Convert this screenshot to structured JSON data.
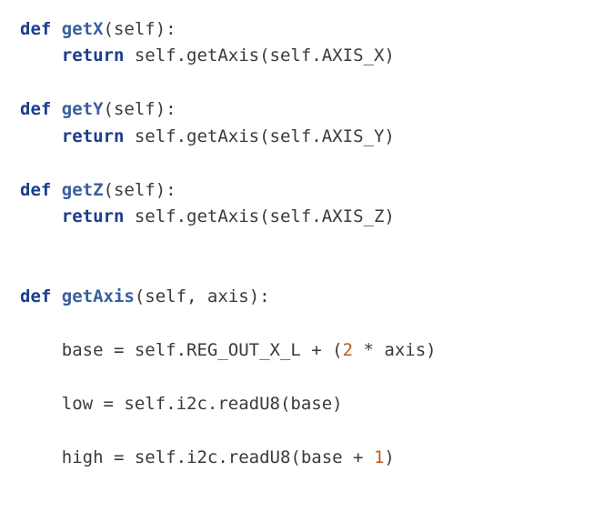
{
  "code": {
    "line1_def": "def",
    "line1_fn": "getX",
    "line1_rest": "(self):",
    "line2_ret": "return",
    "line2_rest": " self.getAxis(self.AXIS_X)",
    "line3_def": "def",
    "line3_fn": "getY",
    "line3_rest": "(self):",
    "line4_ret": "return",
    "line4_rest": " self.getAxis(self.AXIS_Y)",
    "line5_def": "def",
    "line5_fn": "getZ",
    "line5_rest": "(self):",
    "line6_ret": "return",
    "line6_rest": " self.getAxis(self.AXIS_Z)",
    "line7_def": "def",
    "line7_fn": "getAxis",
    "line7_rest": "(self, axis):",
    "line8_a": "    base = self.REG_OUT_X_L + (",
    "line8_num": "2",
    "line8_b": " * axis)",
    "line9": "    low = self.i2c.readU8(base)",
    "line10_a": "    high = self.i2c.readU8(base + ",
    "line10_num": "1",
    "line10_b": ")"
  }
}
